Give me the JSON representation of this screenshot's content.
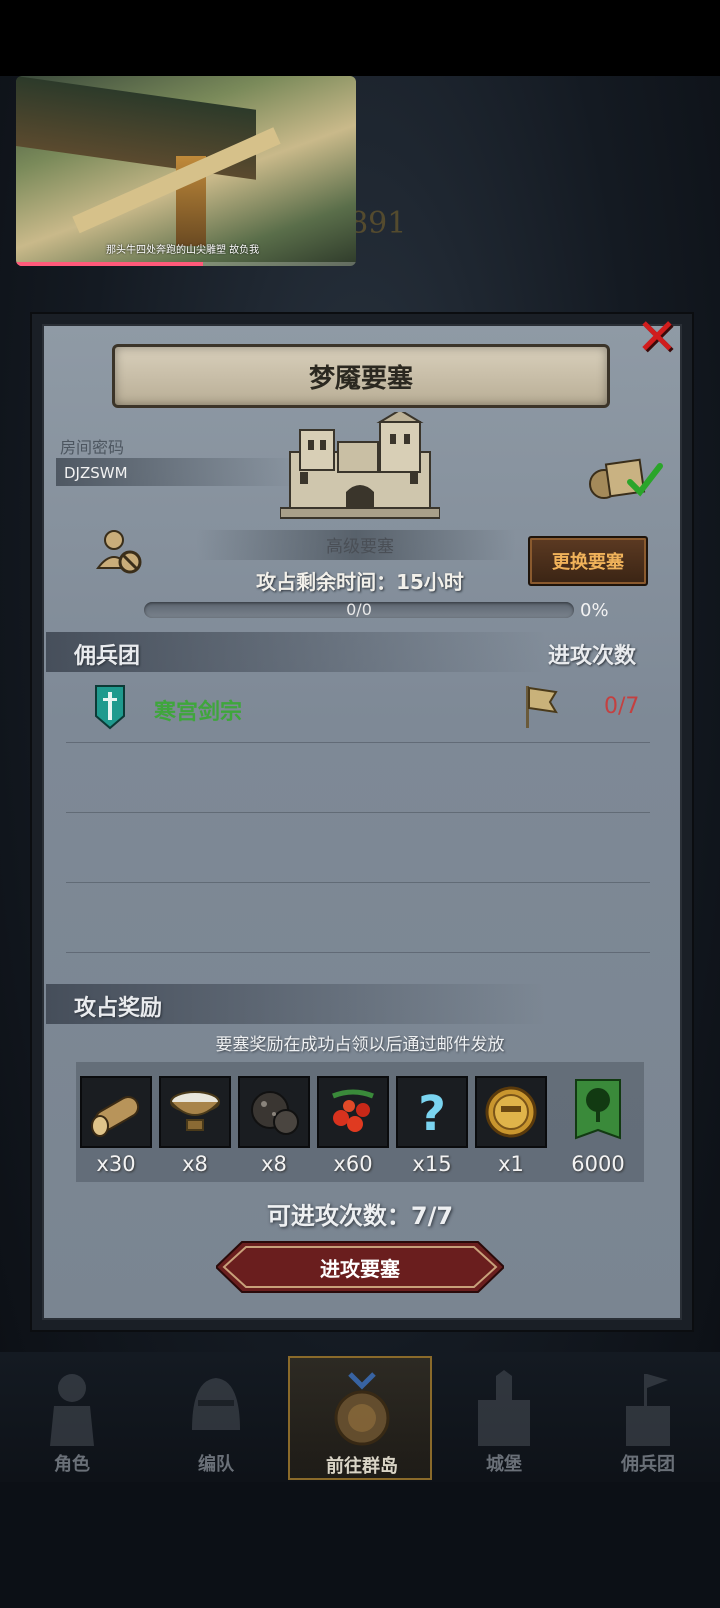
{
  "video": {
    "caption": "那头牛四处奔跑的山尖雕塑 故负我",
    "progress_fraction": 0.55
  },
  "background": {
    "deco_number": "3891"
  },
  "dialog": {
    "title": "梦魇要塞",
    "close_icon": "close-x-icon",
    "room_code_label": "房间密码",
    "room_code_value": "DJZSWM",
    "fortress_name": "高级要塞",
    "change_button": "更换要塞",
    "remaining_time": "攻占剩余时间：15小时",
    "progress": {
      "text": "0/0",
      "percent": "0%"
    },
    "mercenary_header": "佣兵团",
    "attack_count_header": "进攻次数",
    "guilds": [
      {
        "name": "寒宫剑宗",
        "count": "0/7",
        "icon": "shield-sword-icon"
      }
    ],
    "reward_header": "攻占奖励",
    "reward_note": "要塞奖励在成功占领以后通过邮件发放",
    "rewards": [
      {
        "icon": "wood-log-icon",
        "qty": "x30"
      },
      {
        "icon": "bowl-icon",
        "qty": "x8"
      },
      {
        "icon": "ore-rock-icon",
        "qty": "x8"
      },
      {
        "icon": "berries-icon",
        "qty": "x60"
      },
      {
        "icon": "question-mark-icon",
        "qty": "x15"
      },
      {
        "icon": "helmet-coin-icon",
        "qty": "x1"
      },
      {
        "icon": "tree-banner-icon",
        "qty": "6000"
      }
    ],
    "remaining_attacks": "可进攻次数：7/7",
    "attack_button": "进攻要塞"
  },
  "nav": {
    "items": [
      {
        "label": "角色",
        "icon": "knight-icon"
      },
      {
        "label": "编队",
        "icon": "helmet-icon"
      },
      {
        "label": "前往群岛",
        "icon": "compass-icon",
        "active": true
      },
      {
        "label": "城堡",
        "icon": "castle-icon"
      },
      {
        "label": "佣兵团",
        "icon": "banner-castle-icon"
      }
    ]
  },
  "colors": {
    "guild_name": "#3fa63c",
    "guild_count": "#c44040",
    "change_button_text": "#f0b25a",
    "close": "#d11d1d"
  }
}
